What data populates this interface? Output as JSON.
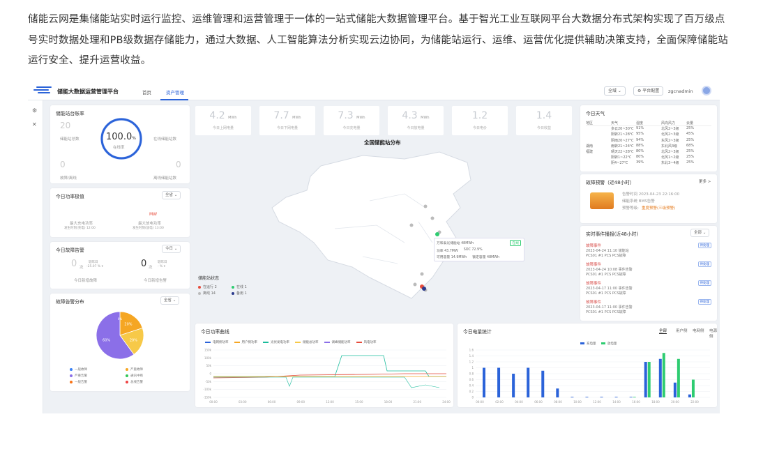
{
  "intro_text": "储能云网是集储能站实时运行监控、运维管理和运营管理于一体的一站式储能大数据管理平台。基于智光工业互联网平台大数据分布式架构实现了百万级点号实时数据处理和PB级数据存储能力，通过大数据、人工智能算法分析实现云边协同，为储能站运行、运维、运营优化提供辅助决策支持，全面保障储能站运行安全、提升运营收益。",
  "app": {
    "title": "储能大数据运营管理平台",
    "nav": [
      "首页",
      "资产管理"
    ],
    "region_select": "全域",
    "platform_btn": "平台配置",
    "user": "zgcnadmin"
  },
  "rail": {
    "icon1": "⚙",
    "icon2": "✕"
  },
  "station_overview": {
    "title": "储能站台账率",
    "rate": "100.0",
    "rate_unit": "%",
    "rate_label": "在线率",
    "labels": [
      "储能站总数",
      "在线储能站数",
      "故障/离线",
      "离线储能站数"
    ],
    "values": [
      "20",
      "",
      "0",
      "0"
    ]
  },
  "power_today": {
    "title": "今日功率极值",
    "select": "全省",
    "left_label": "最大充电功率",
    "left_sub": "发生时刻(充电) 12:00",
    "right_value": "MW",
    "right_label": "最大放电功率",
    "right_sub": "发生时刻(放电) 13:00"
  },
  "status_today": {
    "title": "今日故障告警",
    "select": "今日",
    "left_num": "0",
    "left_unit": "次",
    "left_meta1": "较昨日",
    "left_meta2": "-25.07 % ▾",
    "right_num": "0",
    "right_unit": "次",
    "right_meta1": "较昨日",
    "right_meta2": "- % ▾",
    "left_label": "今日新增故障",
    "right_label": "今日新增告警"
  },
  "fault_dist": {
    "title": "故障告警分布",
    "select": "全省",
    "slices": [
      {
        "label": "20%",
        "value": 20,
        "color": "#f5a623"
      },
      {
        "label": "20%",
        "value": 20,
        "color": "#f7c948"
      },
      {
        "label": "60%",
        "value": 60,
        "color": "#8b6fe8"
      }
    ],
    "center_label": "0%",
    "legend": [
      {
        "name": "一般故障",
        "color": "#3b82f6"
      },
      {
        "name": "严重故障",
        "color": "#f5a623"
      },
      {
        "name": "严重告警",
        "color": "#8b6fe8"
      },
      {
        "name": "通讯中断",
        "color": "#34c759"
      },
      {
        "name": "一般告警",
        "color": "#f97316"
      },
      {
        "name": "总线告警",
        "color": "#ef4444"
      }
    ]
  },
  "kpis": [
    {
      "value": "4.2",
      "unit": "MWh",
      "label": "今日上网电量"
    },
    {
      "value": "7.7",
      "unit": "MWh",
      "label": "今日下网电量"
    },
    {
      "value": "7.3",
      "unit": "MWh",
      "label": "今日充电量"
    },
    {
      "value": "4.3",
      "unit": "MWh",
      "label": "今日放电量"
    },
    {
      "value": "1.2",
      "unit": "",
      "label": "今日电价"
    },
    {
      "value": "1.4",
      "unit": "",
      "label": "今日收益"
    }
  ],
  "map": {
    "title": "全国储能站分布",
    "tooltip_title": "万和泰光储能站 48MWh",
    "tooltip_tag": "在线",
    "tooltip_rows": [
      "功率 43.7MW",
      "SOC 72.9%",
      "可用容量 14.9MWh",
      "额定容量 48MWh"
    ],
    "legend_title": "储能站状态",
    "legend": [
      {
        "name": "在运行 2",
        "color": "#e74c3c"
      },
      {
        "name": "在线 1",
        "color": "#2ecc71"
      },
      {
        "name": "离线 14",
        "color": "#bbbbbb"
      },
      {
        "name": "备用 1",
        "color": "#2b3a8c"
      }
    ]
  },
  "weather": {
    "title": "今日天气",
    "header": [
      "地区",
      "天气",
      "湿度",
      "风向风力",
      "云量"
    ],
    "rows": [
      [
        "",
        "多云20~30℃",
        "91%",
        "北风2~3级",
        "25%"
      ],
      [
        "",
        "阴转21~28℃",
        "95%",
        "北风2~3级",
        "45%"
      ],
      [
        "",
        "阴雨20~27℃",
        "94%",
        "东风2~3级",
        "25%"
      ],
      [
        "湖南",
        "雨转21~24℃",
        "88%",
        "东北风3级",
        "68%"
      ],
      [
        "福建",
        "晴天22~28℃",
        "80%",
        "北风2~3级",
        "25%"
      ],
      [
        "",
        "阴转1~22℃",
        "80%",
        "北风1~2级",
        "25%"
      ],
      [
        "",
        "阴4~27℃",
        "39%",
        "东北3~4级",
        "25%"
      ]
    ]
  },
  "fault_warn": {
    "title": "故障预警（近48小时）",
    "more": "更多 >",
    "line1": "告警时间 2023-04-23 22:16:00",
    "line2": "储能系统 BMS告警",
    "line3_label": "预警等级:",
    "line3_value": "重度预警(三级预警)"
  },
  "events": {
    "title": "实时事件播报(近48小时)",
    "select": "全部",
    "items": [
      {
        "h": "故障事件",
        "d": "2023-04-24 11:10 储能站",
        "s": "PCS01 #1 PCS PCS故障",
        "tag": "待处理"
      },
      {
        "h": "故障事件",
        "d": "2023-04-24 10:08 事件告警",
        "s": "PCS01 #1 PCS PCS故障",
        "tag": "待处理"
      },
      {
        "h": "故障事件",
        "d": "2023-04-17 11:00 事件告警",
        "s": "PCS01 #1 PCS PCS故障",
        "tag": "待处理"
      },
      {
        "h": "故障事件",
        "d": "2023-04-17 11:00 事件告警",
        "s": "PCS01 #1 PCS PCS故障",
        "tag": "待处理"
      }
    ]
  },
  "power_curve": {
    "title": "今日功率曲线",
    "legend": [
      "电网侧功率",
      "用户侧功率",
      "光伏发电功率",
      "储能总功率",
      "调峰储能功率",
      "风电功率"
    ],
    "legend_colors": [
      "#2b63d9",
      "#f5a623",
      "#1abc9c",
      "#f7c948",
      "#8b6fe8",
      "#e74c3c"
    ],
    "y_ticks": [
      "150k",
      "100k",
      "50k",
      "0",
      "-50k",
      "-100k",
      "-150k"
    ],
    "x_ticks": [
      "00:00",
      "03:00",
      "06:00",
      "09:00",
      "12:00",
      "15:00",
      "18:00",
      "21:00",
      "24:00"
    ]
  },
  "energy_stats": {
    "title": "今日电量统计",
    "tabs": [
      "全部",
      "用户侧",
      "电网侧",
      "电源侧"
    ],
    "legend": [
      "充电量",
      "放电量"
    ],
    "y_ticks": [
      "1.6",
      "1.4",
      "1.2",
      "1",
      "0.8",
      "0.6",
      "0.4",
      "0.2",
      "0"
    ],
    "x_ticks": [
      "00:00",
      "02:00",
      "04:00",
      "06:00",
      "08:00",
      "10:00",
      "12:00",
      "14:00",
      "16:00",
      "18:00",
      "20:00",
      "22:00"
    ],
    "charge": [
      1.0,
      1.0,
      0.8,
      1.0,
      0.9,
      0.3,
      0.02,
      0.02,
      0.02,
      0.02,
      0.02,
      1.2,
      1.3,
      0.5,
      0.1
    ],
    "discharge": [
      0,
      0,
      0,
      0,
      0,
      0,
      0,
      0,
      0,
      0,
      0.02,
      1.2,
      1.5,
      1.3,
      0.6
    ]
  }
}
